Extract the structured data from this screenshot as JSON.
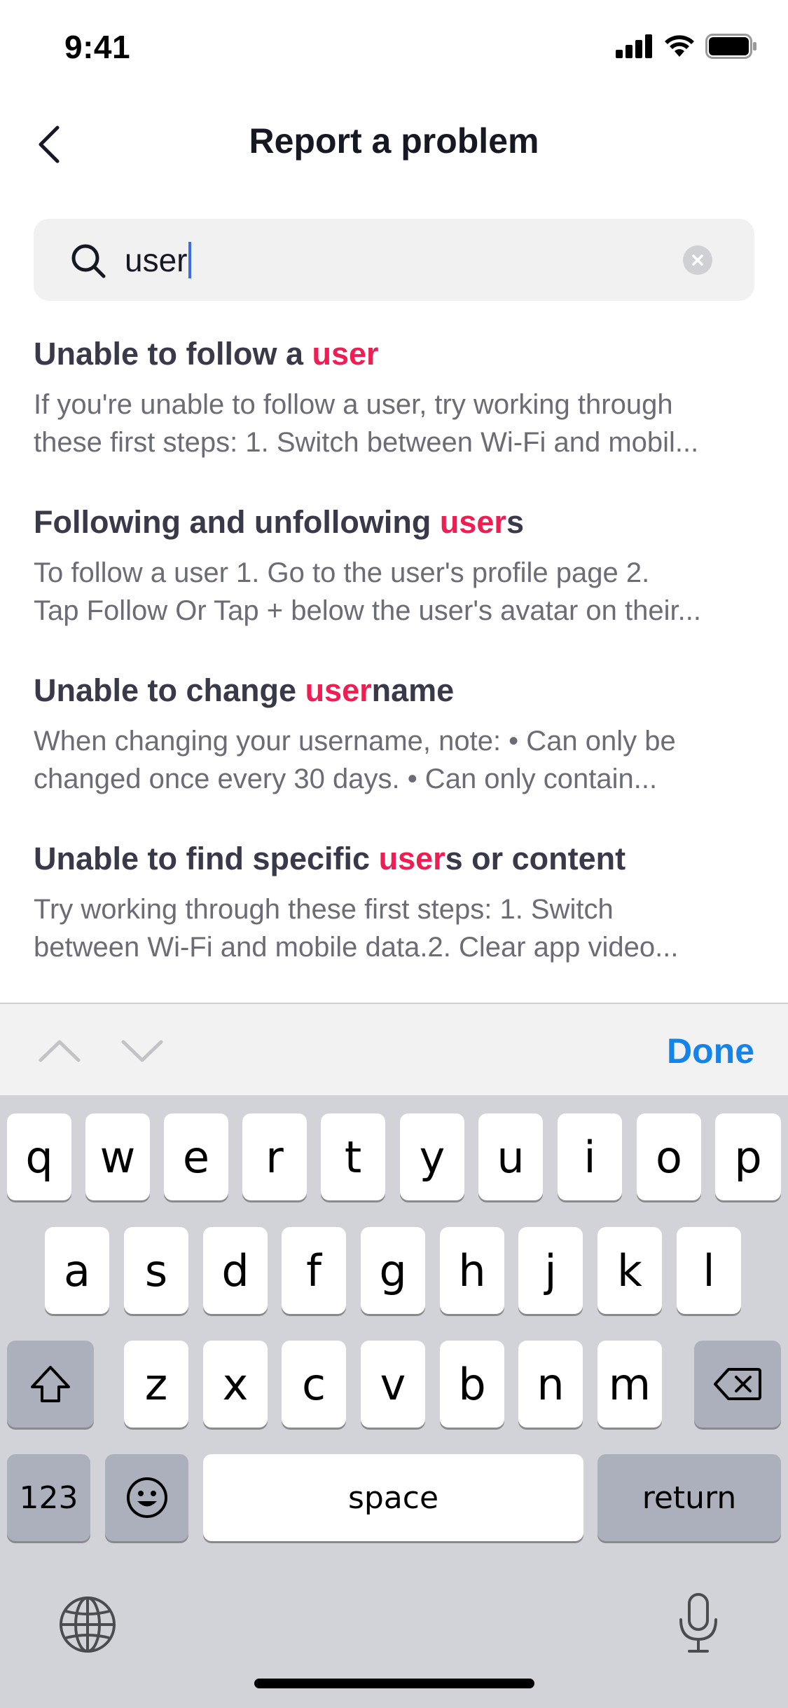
{
  "status_bar": {
    "time": "9:41"
  },
  "header": {
    "title": "Report a problem"
  },
  "search": {
    "value": "user"
  },
  "results": [
    {
      "pre": "Unable to follow a ",
      "hl": "user",
      "post": "",
      "desc1": "If you're unable to follow a user, try working through",
      "desc2": "these first steps: 1. Switch between Wi-Fi and mobil..."
    },
    {
      "pre": "Following and unfollowing ",
      "hl": "user",
      "post": "s",
      "desc1": "To follow a user 1. Go to the user's profile page 2.",
      "desc2": "Tap Follow Or Tap + below the user's avatar on their..."
    },
    {
      "pre": "Unable to change ",
      "hl": "user",
      "post": "name",
      "desc1": "When changing your username, note: • Can only be",
      "desc2": "changed once every 30 days. • Can only contain..."
    },
    {
      "pre": "Unable to find specific ",
      "hl": "user",
      "post": "s or content",
      "desc1": "Try working through these first steps: 1. Switch",
      "desc2": "between Wi-Fi and mobile data.2. Clear app video..."
    }
  ],
  "accessory": {
    "done_label": "Done"
  },
  "keyboard": {
    "row1": [
      "q",
      "w",
      "e",
      "r",
      "t",
      "y",
      "u",
      "i",
      "o",
      "p"
    ],
    "row2": [
      "a",
      "s",
      "d",
      "f",
      "g",
      "h",
      "j",
      "k",
      "l"
    ],
    "row3": [
      "z",
      "x",
      "c",
      "v",
      "b",
      "n",
      "m"
    ],
    "numbers_label": "123",
    "space_label": "space",
    "return_label": "return"
  },
  "colors": {
    "highlight": "#ee1d52",
    "done": "#1584e8",
    "caret": "#3a6ee8"
  },
  "icons": [
    "back-chevron-icon",
    "search-icon",
    "clear-icon",
    "chevron-up-icon",
    "chevron-down-icon",
    "shift-icon",
    "delete-icon",
    "emoji-icon",
    "globe-icon",
    "microphone-icon",
    "signal-icon",
    "wifi-icon",
    "battery-icon"
  ]
}
